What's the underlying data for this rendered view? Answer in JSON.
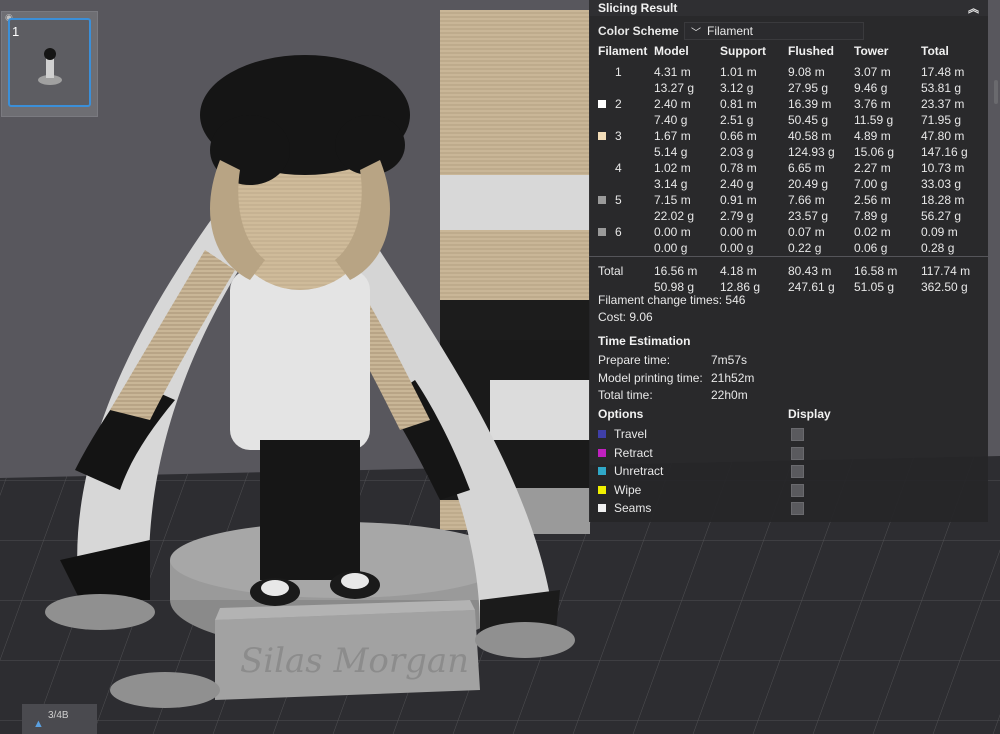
{
  "plate": {
    "number": "1"
  },
  "viewport": {
    "axis_label": "3/4B"
  },
  "panel": {
    "title": "Slicing Result",
    "color_scheme_label": "Color Scheme",
    "color_scheme_value": "Filament",
    "table": {
      "headers": [
        "Filament",
        "Model",
        "Support",
        "Flushed",
        "Tower",
        "Total"
      ],
      "rows": [
        {
          "id": "1",
          "color": "none",
          "model": [
            "4.31 m",
            "13.27 g"
          ],
          "support": [
            "1.01 m",
            "3.12 g"
          ],
          "flushed": [
            "9.08 m",
            "27.95 g"
          ],
          "tower": [
            "3.07 m",
            "9.46 g"
          ],
          "total": [
            "17.48 m",
            "53.81 g"
          ]
        },
        {
          "id": "2",
          "color": "#ffffff",
          "model": [
            "2.40 m",
            "7.40 g"
          ],
          "support": [
            "0.81 m",
            "2.51 g"
          ],
          "flushed": [
            "16.39 m",
            "50.45 g"
          ],
          "tower": [
            "3.76 m",
            "11.59 g"
          ],
          "total": [
            "23.37 m",
            "71.95 g"
          ]
        },
        {
          "id": "3",
          "color": "#f2dcb8",
          "model": [
            "1.67 m",
            "5.14 g"
          ],
          "support": [
            "0.66 m",
            "2.03 g"
          ],
          "flushed": [
            "40.58 m",
            "124.93 g"
          ],
          "tower": [
            "4.89 m",
            "15.06 g"
          ],
          "total": [
            "47.80 m",
            "147.16 g"
          ]
        },
        {
          "id": "4",
          "color": "none",
          "model": [
            "1.02 m",
            "3.14 g"
          ],
          "support": [
            "0.78 m",
            "2.40 g"
          ],
          "flushed": [
            "6.65 m",
            "20.49 g"
          ],
          "tower": [
            "2.27 m",
            "7.00 g"
          ],
          "total": [
            "10.73 m",
            "33.03 g"
          ]
        },
        {
          "id": "5",
          "color": "#9a9a9a",
          "model": [
            "7.15 m",
            "22.02 g"
          ],
          "support": [
            "0.91 m",
            "2.79 g"
          ],
          "flushed": [
            "7.66 m",
            "23.57 g"
          ],
          "tower": [
            "2.56 m",
            "7.89 g"
          ],
          "total": [
            "18.28 m",
            "56.27 g"
          ]
        },
        {
          "id": "6",
          "color": "#9a9a9a",
          "model": [
            "0.00 m",
            "0.00 g"
          ],
          "support": [
            "0.00 m",
            "0.00 g"
          ],
          "flushed": [
            "0.07 m",
            "0.22 g"
          ],
          "tower": [
            "0.02 m",
            "0.06 g"
          ],
          "total": [
            "0.09 m",
            "0.28 g"
          ]
        }
      ],
      "total": {
        "label": "Total",
        "model": [
          "16.56 m",
          "50.98 g"
        ],
        "support": [
          "4.18 m",
          "12.86 g"
        ],
        "flushed": [
          "80.43 m",
          "247.61 g"
        ],
        "tower": [
          "16.58 m",
          "51.05 g"
        ],
        "total": [
          "117.74 m",
          "362.50 g"
        ]
      }
    },
    "filament_change_label": "Filament change times:",
    "filament_change_value": "546",
    "cost_label": "Cost:",
    "cost_value": "9.06",
    "time_title": "Time Estimation",
    "prepare_label": "Prepare time:",
    "prepare_value": "7m57s",
    "printing_label": "Model printing time:",
    "printing_value": "21h52m",
    "total_time_label": "Total time:",
    "total_time_value": "22h0m",
    "options_title": "Options",
    "display_title": "Display",
    "options": [
      {
        "label": "Travel",
        "color": "#3f3fa8"
      },
      {
        "label": "Retract",
        "color": "#c020c0"
      },
      {
        "label": "Unretract",
        "color": "#30a8c8"
      },
      {
        "label": "Wipe",
        "color": "#f0f000"
      },
      {
        "label": "Seams",
        "color": "#f0f0f0"
      }
    ]
  }
}
